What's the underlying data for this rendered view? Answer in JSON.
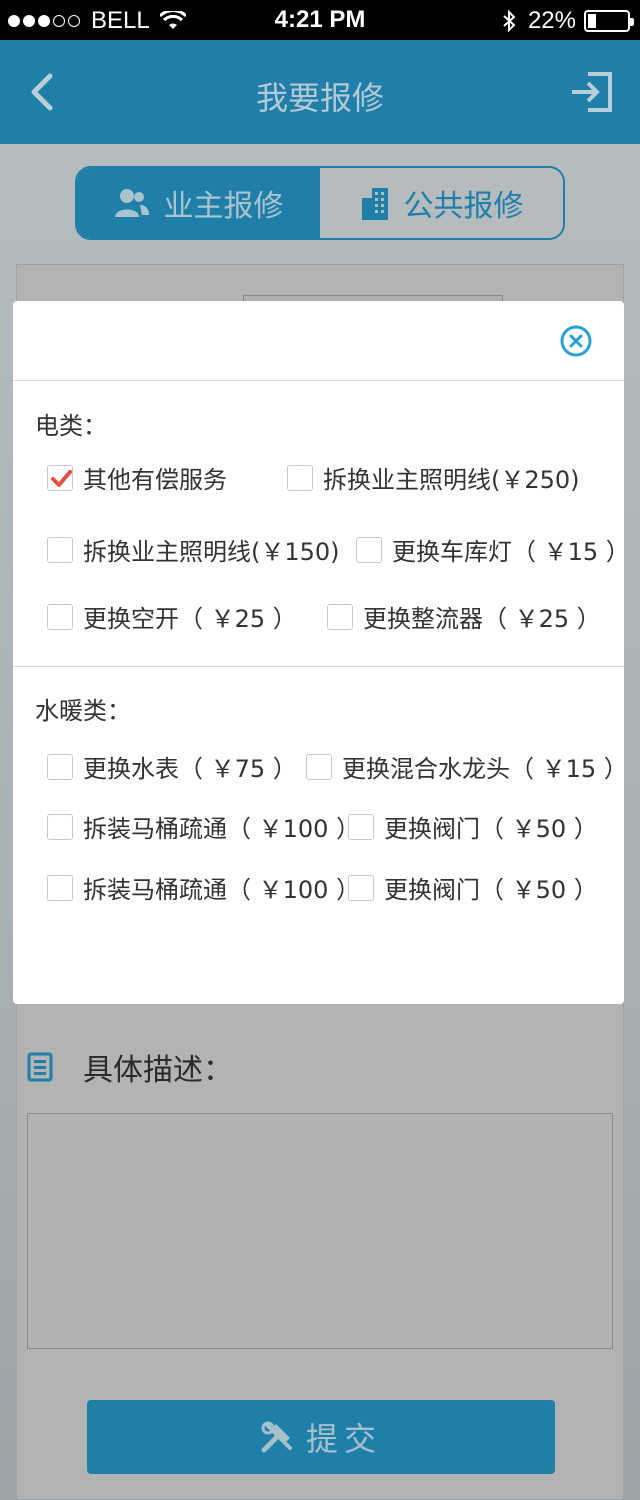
{
  "status_bar": {
    "carrier": "BELL",
    "time": "4:21 PM",
    "battery": "22%",
    "battery_level": 0.22
  },
  "navbar": {
    "title": "我要报修"
  },
  "segment": {
    "tab_owner": "业主报修",
    "tab_public": "公共报修"
  },
  "form": {
    "description_label": "具体描述：",
    "description_value": "",
    "submit_label": "提交"
  },
  "modal": {
    "electric": {
      "title": "电类：",
      "options": [
        {
          "label": "其他有偿服务",
          "checked": true
        },
        {
          "label": "拆换业主照明线(￥250)",
          "checked": false
        },
        {
          "label": "拆换业主照明线(￥150)",
          "checked": false
        },
        {
          "label": "更换车库灯（ ￥15 ）",
          "checked": false
        },
        {
          "label": "更换空开（ ￥25 ）",
          "checked": false
        },
        {
          "label": "更换整流器（ ￥25 ）",
          "checked": false
        }
      ]
    },
    "plumbing": {
      "title": "水暖类：",
      "options": [
        {
          "label": "更换水表（ ￥75 ）",
          "checked": false
        },
        {
          "label": "更换混合水龙头（ ￥15 ）",
          "checked": false
        },
        {
          "label": "拆装马桶疏通（ ￥100 ）",
          "checked": false
        },
        {
          "label": "更换阀门（ ￥50 ）",
          "checked": false
        },
        {
          "label": "拆装马桶疏通（ ￥100 ）",
          "checked": false
        },
        {
          "label": "更换阀门（ ￥50 ）",
          "checked": false
        }
      ]
    }
  },
  "colors": {
    "primary": "#1f7fa8",
    "check": "#e0524a",
    "close": "#2aa0d8"
  }
}
